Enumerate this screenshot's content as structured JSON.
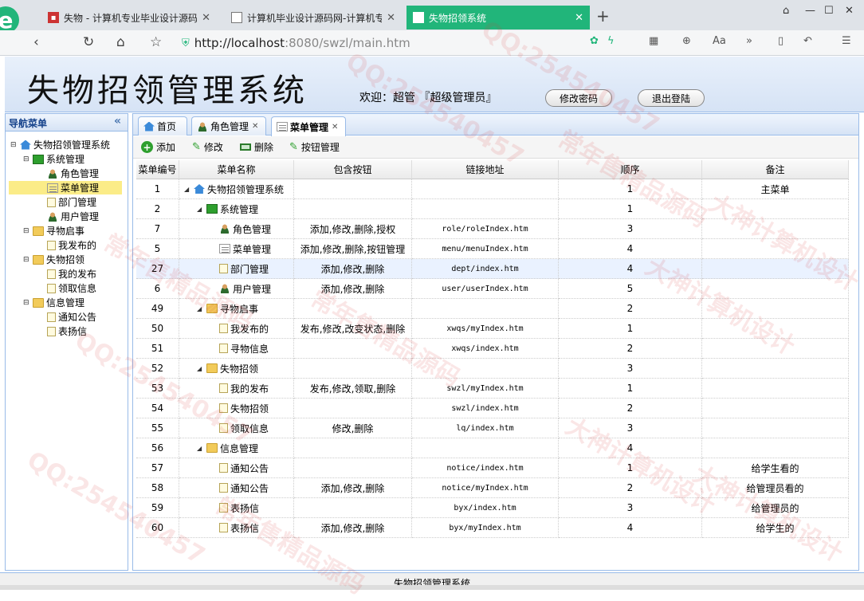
{
  "browser": {
    "tabs": [
      {
        "title": "失物 - 计算机专业毕业设计源码",
        "active": false
      },
      {
        "title": "计算机毕业设计源码网-计算机专",
        "active": false
      },
      {
        "title": "失物招领系统",
        "active": true
      }
    ],
    "new_tab": "+",
    "url_host": "http://localhost",
    "url_path": ":8080/swzl/main.htm",
    "accent": "#21b57a"
  },
  "header": {
    "title": "失物招领管理系统",
    "welcome": "欢迎：超管 『超级管理员』",
    "change_pwd": "修改密码",
    "logout": "退出登陆"
  },
  "nav": {
    "title": "导航菜单",
    "collapse": "«",
    "tree": [
      {
        "label": "失物招领管理系统",
        "icon": "home-icon",
        "level": 0
      },
      {
        "label": "系统管理",
        "icon": "green-square-icon",
        "level": 1
      },
      {
        "label": "角色管理",
        "icon": "user-icon",
        "level": 2
      },
      {
        "label": "菜单管理",
        "icon": "menu-icon",
        "level": 2,
        "selected": true
      },
      {
        "label": "部门管理",
        "icon": "doc-icon",
        "level": 2
      },
      {
        "label": "用户管理",
        "icon": "user-icon",
        "level": 2
      },
      {
        "label": "寻物启事",
        "icon": "folder-icon",
        "level": 1
      },
      {
        "label": "我发布的",
        "icon": "doc-icon",
        "level": 2
      },
      {
        "label": "失物招领",
        "icon": "folder-icon",
        "level": 1
      },
      {
        "label": "我的发布",
        "icon": "doc-icon",
        "level": 2
      },
      {
        "label": "领取信息",
        "icon": "doc-icon",
        "level": 2
      },
      {
        "label": "信息管理",
        "icon": "folder-icon",
        "level": 1
      },
      {
        "label": "通知公告",
        "icon": "doc-icon",
        "level": 2
      },
      {
        "label": "表扬信",
        "icon": "doc-icon",
        "level": 2
      }
    ]
  },
  "page_tabs": [
    {
      "label": "首页",
      "icon": "home-icon",
      "closable": false
    },
    {
      "label": "角色管理",
      "icon": "user-icon",
      "closable": true
    },
    {
      "label": "菜单管理",
      "icon": "menu-icon",
      "closable": true,
      "active": true
    }
  ],
  "toolbar": {
    "add": "添加",
    "edit": "修改",
    "delete": "删除",
    "button_mgmt": "按钮管理"
  },
  "grid": {
    "columns": [
      "菜单编号",
      "菜单名称",
      "包含按钮",
      "链接地址",
      "顺序",
      "备注"
    ],
    "rows": [
      {
        "id": "1",
        "name": "失物招领管理系统",
        "level": 0,
        "icon": "home-icon",
        "expanded": true,
        "buttons": "",
        "url": "",
        "order": "1",
        "note": "主菜单"
      },
      {
        "id": "2",
        "name": "系统管理",
        "level": 1,
        "icon": "green-square-icon",
        "expanded": true,
        "buttons": "",
        "url": "",
        "order": "1",
        "note": ""
      },
      {
        "id": "7",
        "name": "角色管理",
        "level": 2,
        "icon": "user-icon",
        "buttons": "添加,修改,删除,授权",
        "url": "role/roleIndex.htm",
        "order": "3",
        "note": ""
      },
      {
        "id": "5",
        "name": "菜单管理",
        "level": 2,
        "icon": "menu-icon",
        "buttons": "添加,修改,删除,按钮管理",
        "url": "menu/menuIndex.htm",
        "order": "4",
        "note": ""
      },
      {
        "id": "27",
        "name": "部门管理",
        "level": 2,
        "icon": "doc-icon",
        "buttons": "添加,修改,删除",
        "url": "dept/index.htm",
        "order": "4",
        "note": "",
        "highlight": true
      },
      {
        "id": "6",
        "name": "用户管理",
        "level": 2,
        "icon": "user-icon",
        "buttons": "添加,修改,删除",
        "url": "user/userIndex.htm",
        "order": "5",
        "note": ""
      },
      {
        "id": "49",
        "name": "寻物启事",
        "level": 1,
        "icon": "folder-icon",
        "expanded": true,
        "buttons": "",
        "url": "",
        "order": "2",
        "note": ""
      },
      {
        "id": "50",
        "name": "我发布的",
        "level": 2,
        "icon": "doc-icon",
        "buttons": "发布,修改,改变状态,删除",
        "url": "xwqs/myIndex.htm",
        "order": "1",
        "note": ""
      },
      {
        "id": "51",
        "name": "寻物信息",
        "level": 2,
        "icon": "doc-icon",
        "buttons": "",
        "url": "xwqs/index.htm",
        "order": "2",
        "note": ""
      },
      {
        "id": "52",
        "name": "失物招领",
        "level": 1,
        "icon": "folder-icon",
        "expanded": true,
        "buttons": "",
        "url": "",
        "order": "3",
        "note": ""
      },
      {
        "id": "53",
        "name": "我的发布",
        "level": 2,
        "icon": "doc-icon",
        "buttons": "发布,修改,领取,删除",
        "url": "swzl/myIndex.htm",
        "order": "1",
        "note": ""
      },
      {
        "id": "54",
        "name": "失物招领",
        "level": 2,
        "icon": "doc-icon",
        "buttons": "",
        "url": "swzl/index.htm",
        "order": "2",
        "note": ""
      },
      {
        "id": "55",
        "name": "领取信息",
        "level": 2,
        "icon": "doc-icon",
        "buttons": "修改,删除",
        "url": "lq/index.htm",
        "order": "3",
        "note": ""
      },
      {
        "id": "56",
        "name": "信息管理",
        "level": 1,
        "icon": "folder-icon",
        "expanded": true,
        "buttons": "",
        "url": "",
        "order": "4",
        "note": ""
      },
      {
        "id": "57",
        "name": "通知公告",
        "level": 2,
        "icon": "doc-icon",
        "buttons": "",
        "url": "notice/index.htm",
        "order": "1",
        "note": "给学生看的"
      },
      {
        "id": "58",
        "name": "通知公告",
        "level": 2,
        "icon": "doc-icon",
        "buttons": "添加,修改,删除",
        "url": "notice/myIndex.htm",
        "order": "2",
        "note": "给管理员看的"
      },
      {
        "id": "59",
        "name": "表扬信",
        "level": 2,
        "icon": "doc-icon",
        "buttons": "",
        "url": "byx/index.htm",
        "order": "3",
        "note": "给管理员的"
      },
      {
        "id": "60",
        "name": "表扬信",
        "level": 2,
        "icon": "doc-icon",
        "buttons": "添加,修改,删除",
        "url": "byx/myIndex.htm",
        "order": "4",
        "note": "给学生的"
      }
    ]
  },
  "footer": {
    "text": "失物招领管理系统"
  },
  "watermarks": [
    "QQ:254540457",
    "常年售精品源码",
    "大神计算机设计"
  ]
}
